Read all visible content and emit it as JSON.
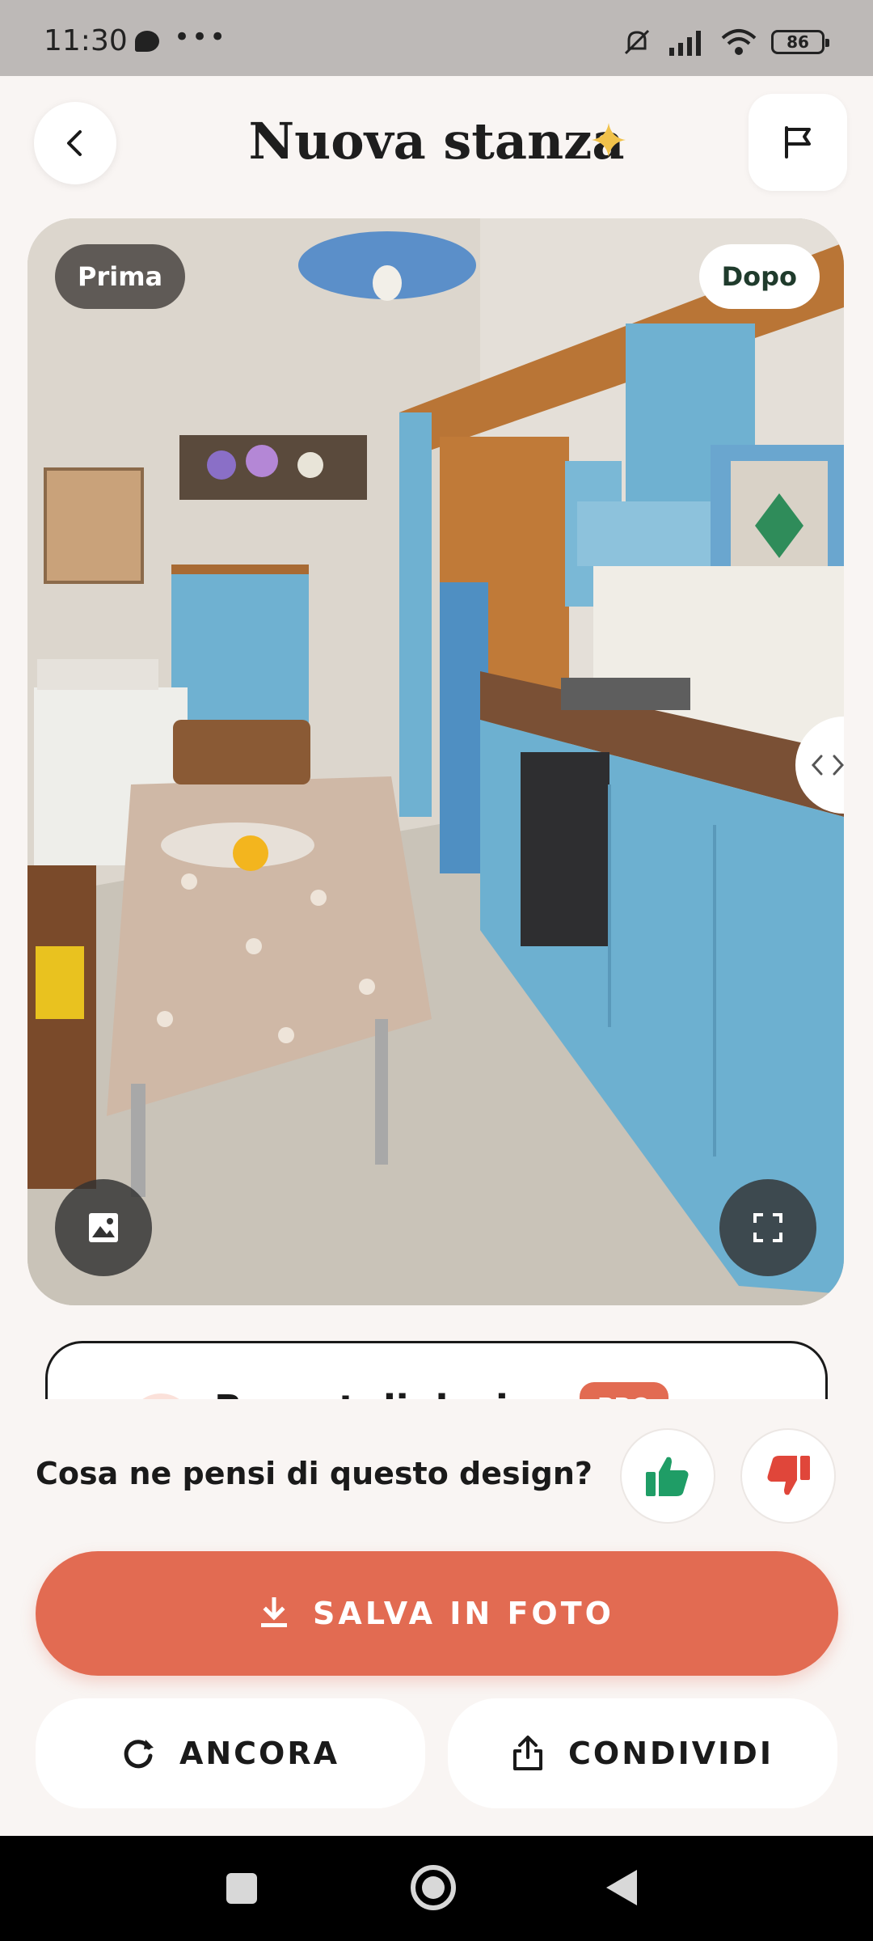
{
  "status_bar": {
    "time": "11:30",
    "dots": "•••",
    "battery": "86"
  },
  "header": {
    "title": "Nuova stanza"
  },
  "image": {
    "before_label": "Prima",
    "after_label": "Dopo"
  },
  "report": {
    "title": "Report di design",
    "badge": "PRO"
  },
  "feedback": {
    "question": "Cosa ne pensi di questo design?"
  },
  "actions": {
    "save_label": "SALVA IN FOTO",
    "again_label": "ANCORA",
    "share_label": "CONDIVIDI"
  },
  "colors": {
    "accent": "#e26b52",
    "thumb_up": "#1f9d66",
    "thumb_down": "#e0463a"
  }
}
